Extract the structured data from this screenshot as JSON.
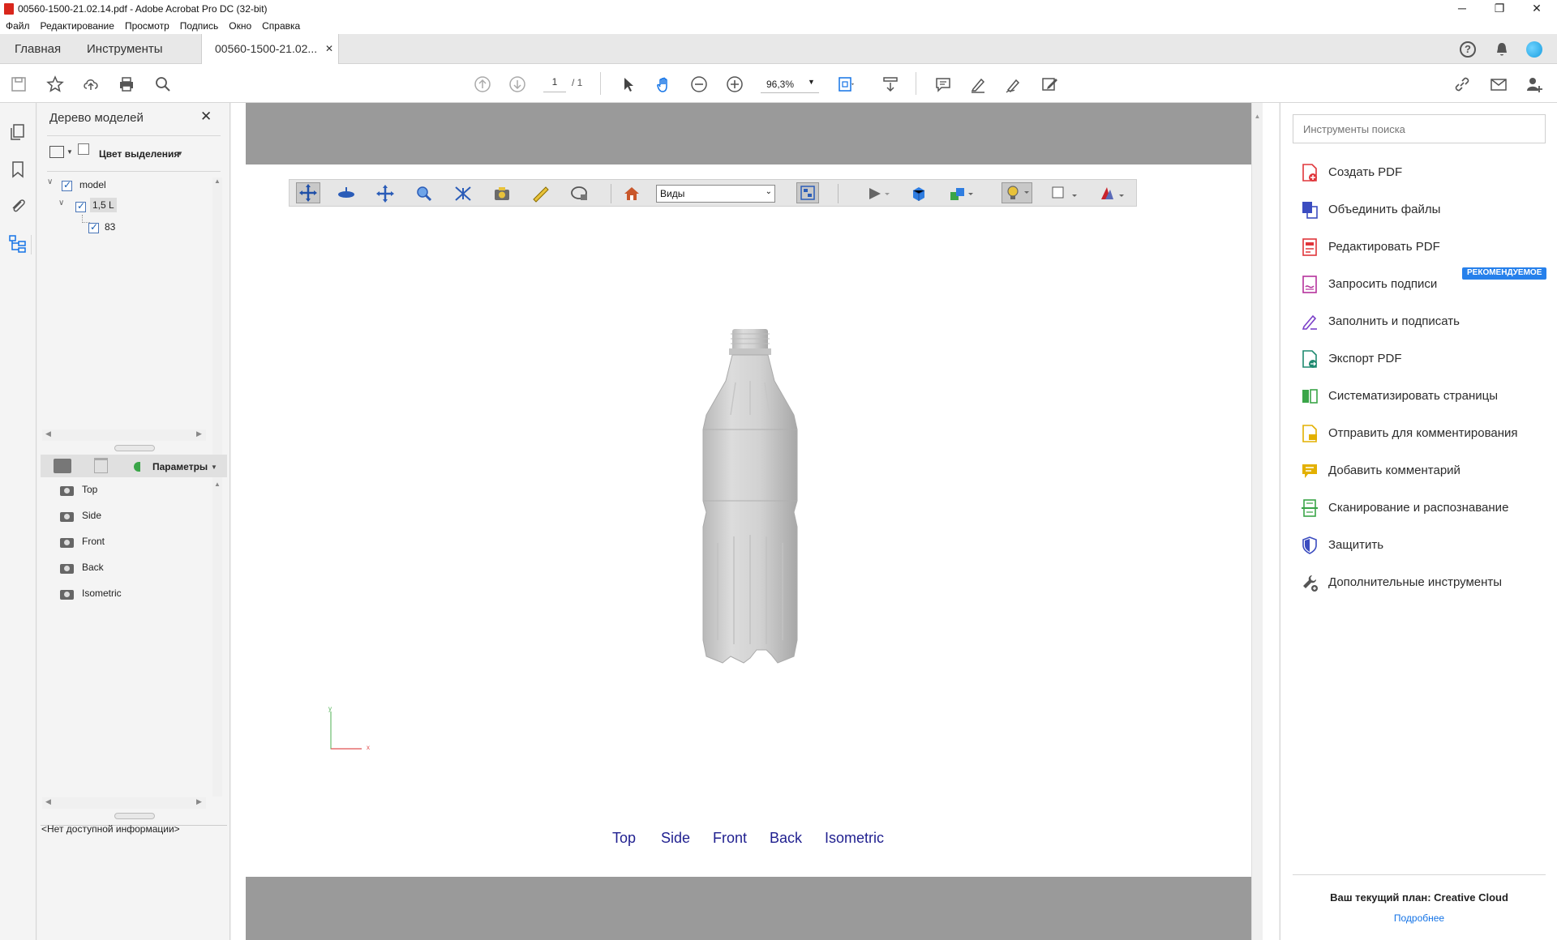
{
  "window": {
    "title": "00560-1500-21.02.14.pdf - Adobe Acrobat Pro DC (32-bit)",
    "minimize": "─",
    "maximize": "❐",
    "close": "✕"
  },
  "menu": [
    "Файл",
    "Редактирование",
    "Просмотр",
    "Подпись",
    "Окно",
    "Справка"
  ],
  "tabs": {
    "home": "Главная",
    "tools": "Инструменты",
    "document": "00560-1500-21.02...",
    "close": "✕"
  },
  "toolbar": {
    "page_current": "1",
    "page_total": "/ 1",
    "zoom": "96,3%"
  },
  "model_tree": {
    "title": "Дерево моделей",
    "close": "✕",
    "highlight_color_label": "Цвет выделения",
    "nodes": [
      {
        "label": "model",
        "checked": true
      },
      {
        "label": "1,5 L",
        "checked": true
      },
      {
        "label": "83",
        "checked": true
      }
    ],
    "views_menu_label": "Параметры",
    "views": [
      "Top",
      "Side",
      "Front",
      "Back",
      "Isometric"
    ],
    "info": "<Нет доступной информации>"
  },
  "viewer3d": {
    "views_dropdown": "Виды",
    "axis_y": "y",
    "axis_x": "x",
    "view_links": [
      "Top",
      "Side",
      "Front",
      "Back",
      "Isometric"
    ],
    "background_color": "#ffffff",
    "model_color": "#cfcfcf"
  },
  "right_panel": {
    "search_placeholder": "Инструменты поиска",
    "badge": "РЕКОМЕНДУЕМОЕ",
    "tools": [
      {
        "label": "Создать PDF",
        "color": "#e0363b"
      },
      {
        "label": "Объединить файлы",
        "color": "#3b4cc0"
      },
      {
        "label": "Редактировать PDF",
        "color": "#e0363b"
      },
      {
        "label": "Запросить подписи",
        "color": "#b5329c"
      },
      {
        "label": "Заполнить и подписать",
        "color": "#7a3fc8"
      },
      {
        "label": "Экспорт PDF",
        "color": "#1f8a70"
      },
      {
        "label": "Систематизировать страницы",
        "color": "#3aa548"
      },
      {
        "label": "Отправить для комментирования",
        "color": "#e3b000"
      },
      {
        "label": "Добавить комментарий",
        "color": "#e3b000"
      },
      {
        "label": "Сканирование и распознавание",
        "color": "#3aa548"
      },
      {
        "label": "Защитить",
        "color": "#3b4cc0"
      },
      {
        "label": "Дополнительные инструменты",
        "color": "#555555"
      }
    ],
    "plan": "Ваш текущий план: Creative Cloud",
    "more_link": "Подробнее"
  }
}
